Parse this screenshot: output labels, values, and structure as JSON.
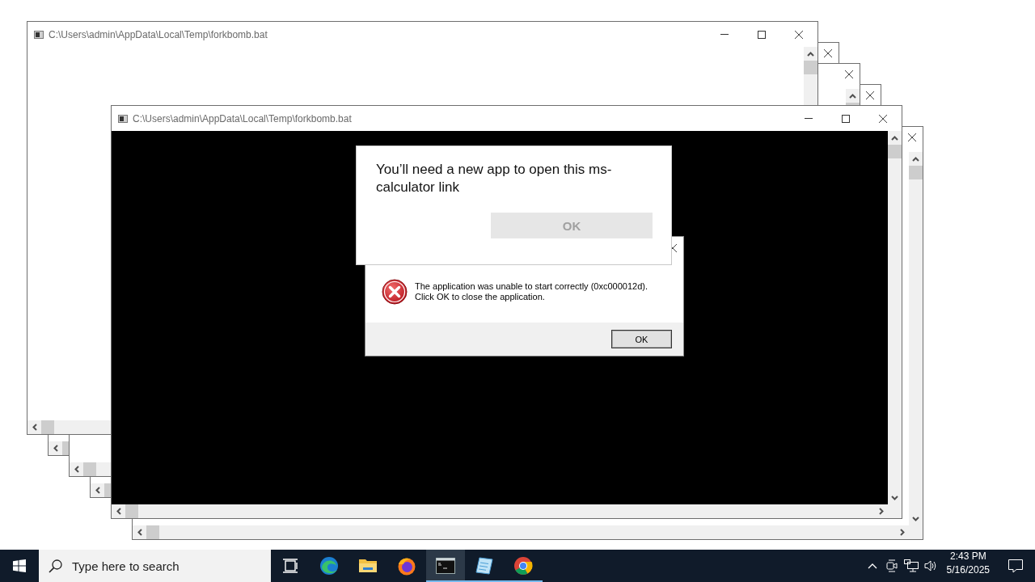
{
  "windows": [
    {
      "title": "C:\\Users\\admin\\AppData\\Local\\Temp\\forkbomb.bat",
      "kind": "blank",
      "controls": [
        {
          "kind": "minimize"
        },
        {
          "kind": "maximize"
        },
        {
          "kind": "close"
        }
      ]
    },
    {
      "kind": "blank",
      "controls": [
        {
          "kind": "close"
        }
      ]
    },
    {
      "kind": "blank",
      "controls": [
        {
          "kind": "close"
        }
      ]
    },
    {
      "kind": "blank",
      "controls": [
        {
          "kind": "close"
        }
      ]
    },
    {
      "title": "C:\\Users\\admin\\AppData\\Local\\Temp\\forkbomb.bat",
      "kind": "console",
      "controls": [
        {
          "kind": "minimize"
        },
        {
          "kind": "maximize"
        },
        {
          "kind": "close"
        }
      ]
    },
    {
      "kind": "blank",
      "controls": [
        {
          "kind": "close"
        }
      ]
    }
  ],
  "error_dialog": {
    "controls": [
      {
        "kind": "close"
      }
    ],
    "message": "The application was unable to start correctly (0xc000012d).\nClick OK to close the application.",
    "button": "OK"
  },
  "app_dialog": {
    "message": "You’ll need a new app to open this ms-\ncalculator link",
    "button": {
      "label": "OK",
      "disabled": true
    }
  },
  "taskbar": {
    "search": {
      "placeholder": "Type here to search"
    },
    "apps": [
      {
        "kind": "task-view",
        "running": false,
        "selected": false
      },
      {
        "kind": "edge",
        "running": false,
        "selected": false
      },
      {
        "kind": "explorer",
        "running": false,
        "selected": false
      },
      {
        "kind": "firefox",
        "running": false,
        "selected": false
      },
      {
        "kind": "console",
        "running": true,
        "selected": true
      },
      {
        "kind": "notepad",
        "running": true,
        "selected": false
      },
      {
        "kind": "chrome",
        "running": true,
        "selected": false
      }
    ],
    "clock": {
      "time": "2:43 PM",
      "date": "5/16/2025"
    }
  }
}
